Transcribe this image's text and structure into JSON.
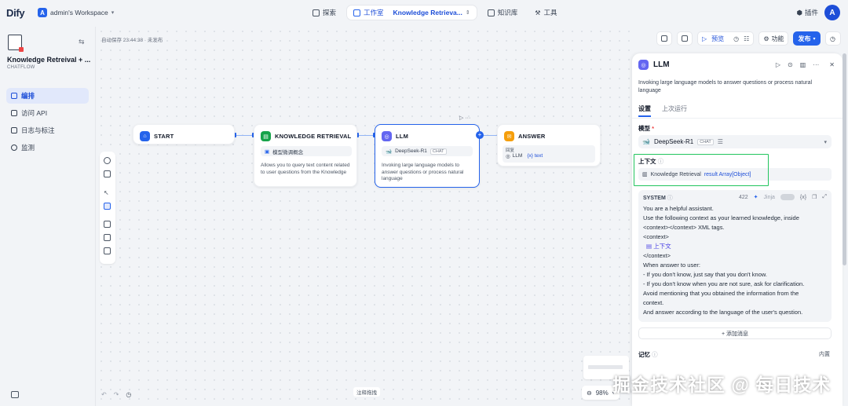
{
  "topbar": {
    "logo": "Dify",
    "workspace_avatar": "A",
    "workspace_name": "admin's Workspace",
    "nav": [
      {
        "label": "探索"
      },
      {
        "label": "工作室",
        "sub": "Knowledge Retrieva..."
      },
      {
        "label": "知识库"
      },
      {
        "label": "工具"
      }
    ],
    "plugins": "插件",
    "user_avatar": "A"
  },
  "sidebar": {
    "app_name": "Knowledge Retreival + ...",
    "app_type": "CHATFLOW",
    "items": [
      {
        "label": "编排",
        "active": true
      },
      {
        "label": "访问 API"
      },
      {
        "label": "日志与标注"
      },
      {
        "label": "监测"
      }
    ]
  },
  "canvas": {
    "autosave": "自动保存 23:44:38 · 未发布",
    "nodes": {
      "start": {
        "title": "START",
        "color": "#2563eb"
      },
      "knowledge": {
        "title": "KNOWLEDGE RETRIEVAL",
        "chip": "模型微调概念",
        "desc": "Allows you to query text content related to user questions from the Knowledge",
        "color": "#16a34a"
      },
      "llm": {
        "title": "LLM",
        "model": "DeepSeek-R1",
        "badge": "CHAT",
        "desc": "Invoking large language models to answer questions or process natural language",
        "color": "#6366f1"
      },
      "answer": {
        "title": "ANSWER",
        "label": "回复",
        "ref_node": "LLM",
        "ref_var": "{x} text",
        "color": "#f59e0b"
      }
    },
    "hint": "注释拖拽",
    "zoom": "98%"
  },
  "actions": {
    "preview": "预览",
    "features": "功能",
    "publish": "发布"
  },
  "panel": {
    "title": "LLM",
    "desc": "Invoking large language models to answer questions or process natural language",
    "tabs": [
      "设置",
      "上次运行"
    ],
    "model_label": "模型",
    "model_name": "DeepSeek-R1",
    "model_badge": "CHAT",
    "context_label": "上下文",
    "context_node": "Knowledge Retrieval",
    "context_var": "result Array[Object]",
    "system": {
      "title": "SYSTEM",
      "count": "422",
      "jinja": "Jinja",
      "var": "{x}",
      "lines": [
        "You are a helpful assistant.",
        "Use the following context as your learned knowledge, inside",
        "<context></context> XML tags.",
        "<context>",
        "上下文",
        "</context>",
        "When answer to user:",
        "- If you don't know, just say that you don't know.",
        "- If you don't know when you are not sure, ask for clarification.",
        "Avoid mentioning that you obtained the information from the",
        "context.",
        "And answer according to the language of the user's question."
      ]
    },
    "add_message": "+ 添加消息",
    "memory": "记忆",
    "builtin": "内置"
  },
  "watermark": "掘金技术社区 @ 每日技术"
}
